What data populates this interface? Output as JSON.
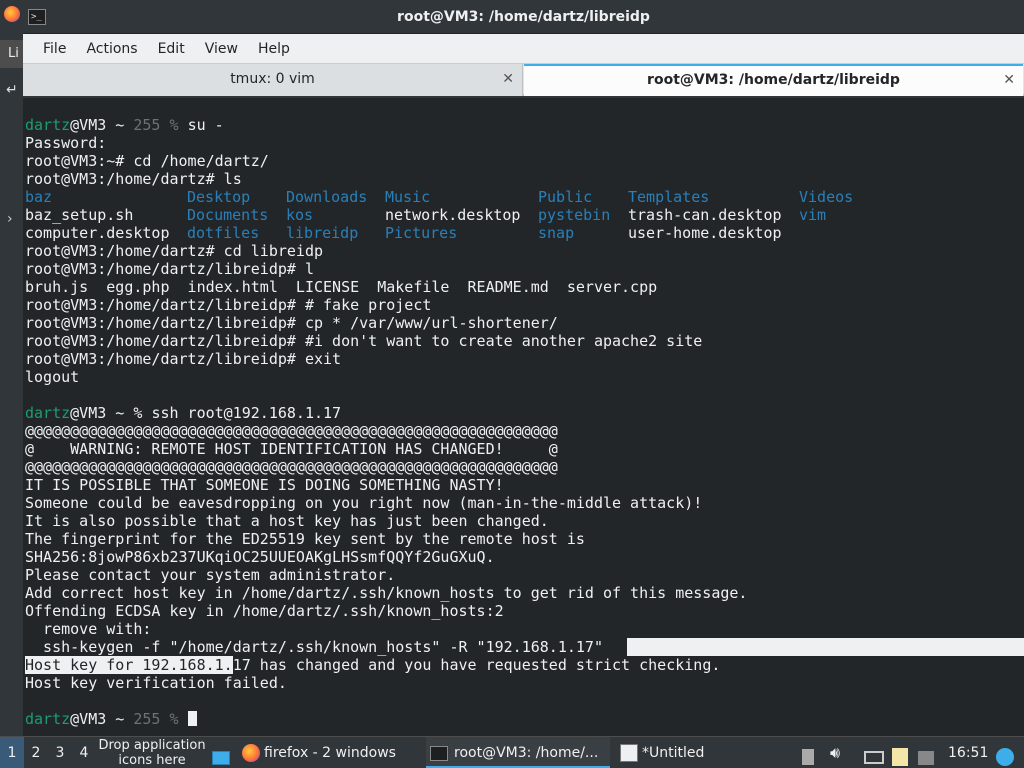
{
  "window": {
    "title": "root@VM3: /home/dartz/libreidp"
  },
  "menu": [
    "File",
    "Actions",
    "Edit",
    "View",
    "Help"
  ],
  "tabs": [
    {
      "label": "tmux: 0 vim",
      "active": false
    },
    {
      "label": "root@VM3: /home/dartz/libreidp",
      "active": true
    }
  ],
  "desktop_left": {
    "label": "Li"
  },
  "terminal": {
    "prompt_user": "dartz",
    "prompt_host": "@VM3 ~ ",
    "exit_code": "255 % ",
    "line1_cmd": "su -",
    "lines_a": [
      "Password:",
      "root@VM3:~# cd /home/dartz/",
      "root@VM3:/home/dartz# ls"
    ],
    "ls_rows": [
      [
        "baz",
        "Desktop",
        "Downloads",
        "Music",
        "Public",
        "Templates",
        "Videos"
      ],
      [
        "baz_setup.sh",
        "Documents",
        "kos",
        "network.desktop",
        "pystebin",
        "trash-can.desktop",
        "vim"
      ],
      [
        "computer.desktop",
        "dotfiles",
        "libreidp",
        "Pictures",
        "snap",
        "user-home.desktop",
        ""
      ]
    ],
    "lines_b": [
      "root@VM3:/home/dartz# cd libreidp",
      "root@VM3:/home/dartz/libreidp# l",
      "bruh.js  egg.php  index.html  LICENSE  Makefile  README.md  server.cpp",
      "root@VM3:/home/dartz/libreidp# # fake project",
      "root@VM3:/home/dartz/libreidp# cp * /var/www/url-shortener/",
      "root@VM3:/home/dartz/libreidp# #i don't want to create another apache2 site",
      "root@VM3:/home/dartz/libreidp# exit",
      "logout"
    ],
    "prompt2": "@VM3 ~ % ",
    "ssh_cmd": "ssh root@192.168.1.17",
    "lines_c": [
      "@@@@@@@@@@@@@@@@@@@@@@@@@@@@@@@@@@@@@@@@@@@@@@@@@@@@@@@@@@@",
      "@    WARNING: REMOTE HOST IDENTIFICATION HAS CHANGED!     @",
      "@@@@@@@@@@@@@@@@@@@@@@@@@@@@@@@@@@@@@@@@@@@@@@@@@@@@@@@@@@@",
      "IT IS POSSIBLE THAT SOMEONE IS DOING SOMETHING NASTY!",
      "Someone could be eavesdropping on you right now (man-in-the-middle attack)!",
      "It is also possible that a host key has just been changed.",
      "The fingerprint for the ED25519 key sent by the remote host is",
      "SHA256:8jowP86xb237UKqiOC25UUEOAKgLHSsmfQQYf2GuGXuQ.",
      "Please contact your system administrator.",
      "Add correct host key in /home/dartz/.ssh/known_hosts to get rid of this message.",
      "Offending ECDSA key in /home/dartz/.ssh/known_hosts:2",
      "  remove with:"
    ],
    "keygen_line": "  ssh-keygen -f \"/home/dartz/.ssh/known_hosts\" -R \"192.168.1.17\"",
    "hostkey_sel": "Host key for 192.168.1.",
    "hostkey_rest": "17 has changed and you have requested strict checking.",
    "verify_failed": "Host key verification failed."
  },
  "taskbar": {
    "workspaces": [
      "1",
      "2",
      "3",
      "4"
    ],
    "drop_text": "Drop application icons here",
    "tasks": [
      {
        "label": "firefox - 2 windows",
        "icon": "firefox-icon"
      },
      {
        "label": "root@VM3: /home/...",
        "icon": "terminal-icon"
      },
      {
        "label": "*Untitled",
        "icon": "editor-icon"
      }
    ],
    "clock": "16:51"
  }
}
